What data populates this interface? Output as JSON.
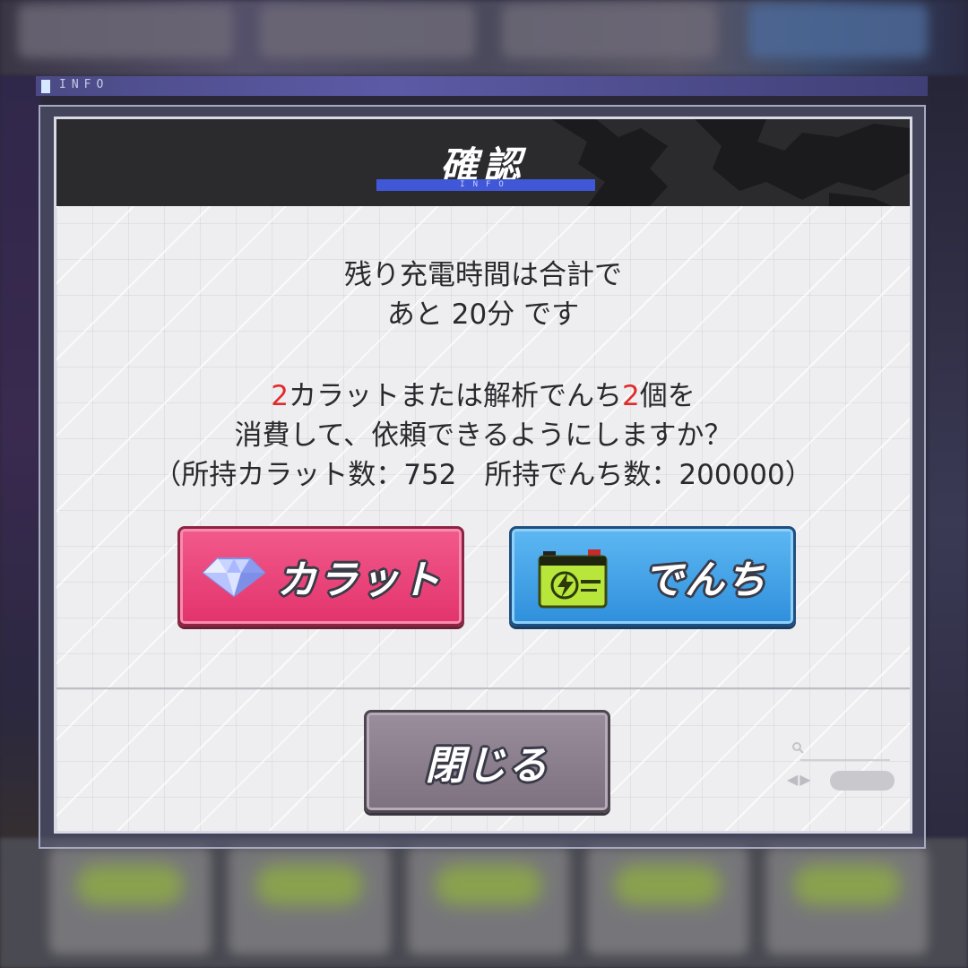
{
  "background": {
    "info_label": "INFO"
  },
  "dialog": {
    "title": "確認",
    "title_sub": "INFO",
    "message_line1": "残り充電時間は合計で",
    "message_line2": "あと 20分 です",
    "cost_carat_num": "2",
    "cost_mid": "カラットまたは解析でんち",
    "cost_denchi_num": "2",
    "cost_end": "個を",
    "question": "消費して、依頼できるようにしますか？",
    "owned_line": "（所持カラット数：752　所持でんち数：200000）"
  },
  "buttons": {
    "carat_label": "カラット",
    "denchi_label": "でんち",
    "close_label": "閉じる"
  },
  "colors": {
    "accent_blue": "#4057d8",
    "carat_button": "#e2336c",
    "denchi_button": "#2f8fdc",
    "close_button": "#7d717f",
    "highlight_red": "#e22a2a"
  },
  "icons": {
    "carat": "diamond-icon",
    "denchi": "battery-icon"
  }
}
